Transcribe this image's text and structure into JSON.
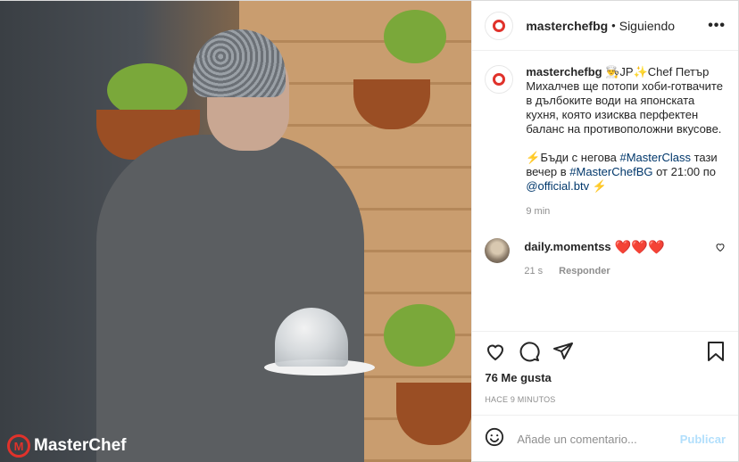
{
  "header": {
    "username": "masterchefbg",
    "separator": "•",
    "follow_state": "Siguiendo",
    "more": "•••"
  },
  "caption": {
    "username": "masterchefbg",
    "prefix": "👨‍🍳JP✨Chef Петър Михалчев ще потопи хоби-готвачите в дълбоките води на японската кухня, която изисква перфектен баланс на противоположни вкусове.",
    "line2_a": "⚡Бъди с негова ",
    "tag1": "#MasterClass",
    "line2_b": " тази вечер в ",
    "tag2": "#MasterChefBG",
    "line2_c": " от 21:00 по ",
    "tag3": "@official.btv",
    "line2_d": " ⚡",
    "time": "9 min"
  },
  "comment": {
    "username": "daily.momentss",
    "text": "❤️❤️❤️",
    "time": "21 s",
    "reply": "Responder"
  },
  "actions": {
    "likes": "76 Me gusta",
    "ago": "HACE 9 MINUTOS"
  },
  "composer": {
    "placeholder": "Añade un comentario...",
    "post": "Publicar"
  },
  "photo": {
    "logo_text": "MasterChef",
    "logo_icon": "M"
  },
  "colors": {
    "accent": "#e0322b",
    "link": "#00376b",
    "post_disabled": "#b2dffc"
  }
}
